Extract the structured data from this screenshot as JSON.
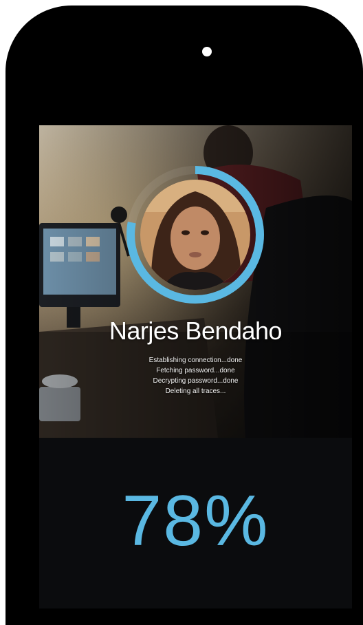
{
  "profile": {
    "name": "Narjes Bendaho"
  },
  "status_log": [
    "Establishing connection...done",
    "Fetching password...done",
    "Decrypting password...done",
    "Deleting all traces..."
  ],
  "progress": {
    "label": "78%",
    "value": 0.78
  },
  "colors": {
    "accent": "#5ab8e2",
    "device": "#000000",
    "screen_background": "#0b0c0e"
  }
}
